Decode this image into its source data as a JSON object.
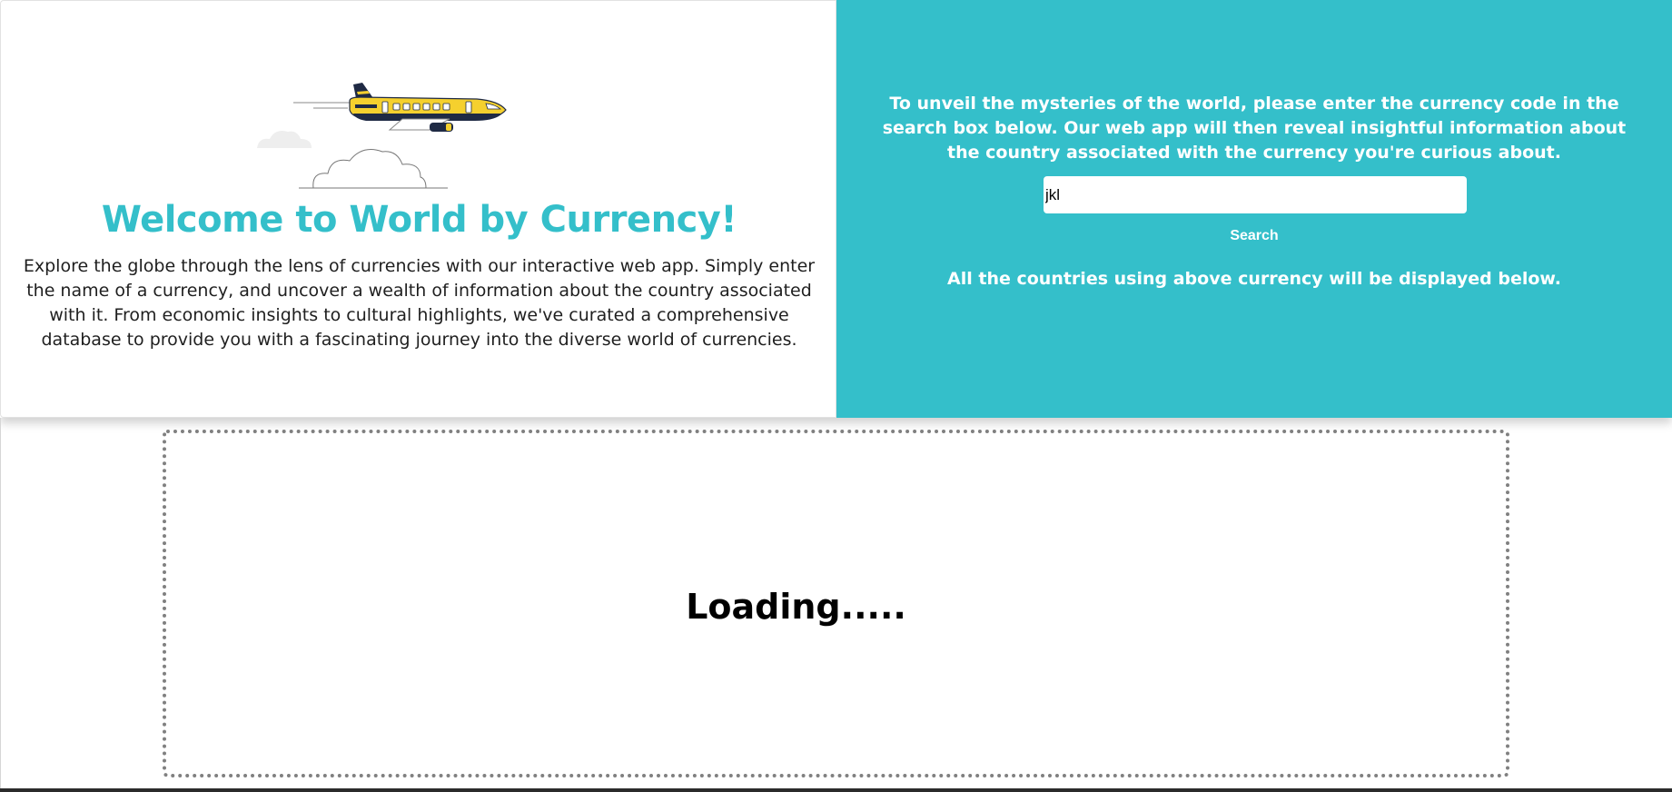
{
  "hero": {
    "title": "Welcome to World by Currency!",
    "description": "Explore the globe through the lens of currencies with our interactive web app. Simply enter the name of a currency, and uncover a wealth of information about the country associated with it. From economic insights to cultural highlights, we've curated a comprehensive database to provide you with a fascinating journey into the diverse world of currencies.",
    "illustration_icon": "airplane-with-clouds-icon"
  },
  "search_panel": {
    "instructions": "To unveil the mysteries of the world, please enter the currency code in the search box below. Our web app will then reveal insightful information about the country associated with the currency you're curious about.",
    "input_value": "jkl",
    "input_placeholder": "",
    "button_label": "Search",
    "results_note": "All the countries using above currency will be displayed below."
  },
  "results": {
    "status_text": "Loading....."
  },
  "colors": {
    "accent": "#34bfca",
    "airplane_body": "#f5d02e",
    "airplane_dark": "#1f2a44"
  }
}
